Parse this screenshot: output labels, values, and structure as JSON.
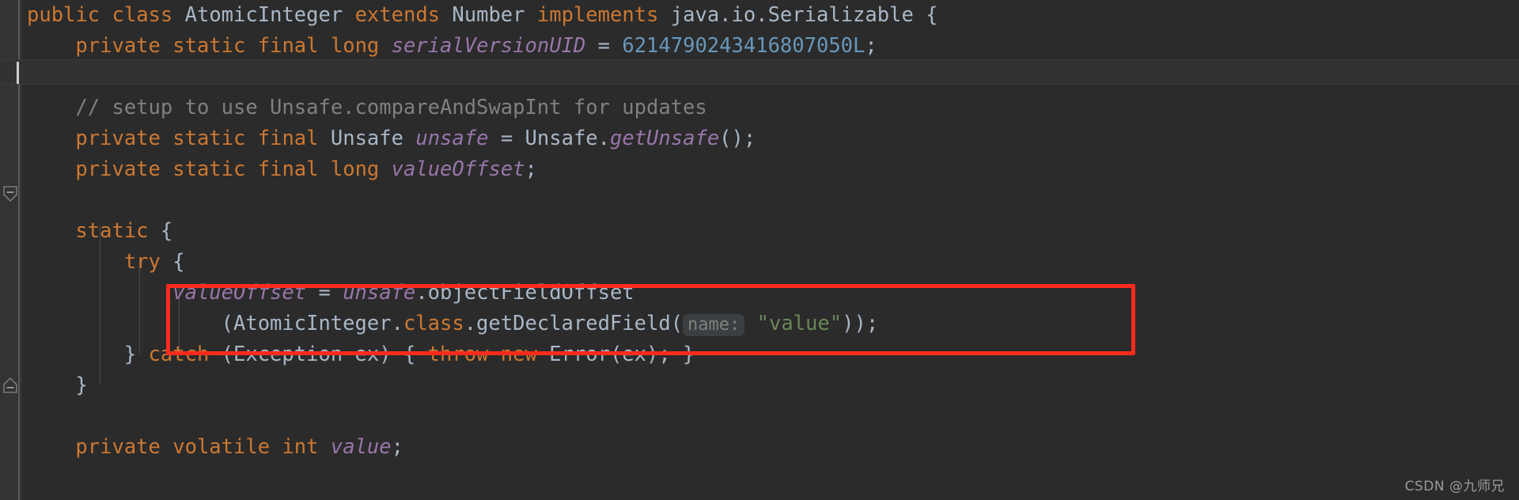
{
  "editor": {
    "theme_name": "darcula",
    "background_color": "#2b2b2b",
    "gutter_color": "#313335",
    "caret_line_color": "#323232",
    "annotation_box_color": "#fb2b1d",
    "colors": {
      "keyword": "#cc7832",
      "class_name": "#a9b7c6",
      "field": "#9876aa",
      "number": "#6897bb",
      "string": "#6a8759",
      "comment": "#808080",
      "param_hint": "#808080",
      "param_hint_bg": "#3c3f41"
    },
    "gutter": {
      "fold_markers": [
        {
          "name": "fold-marker-collapse-static",
          "state": "expanded-start"
        },
        {
          "name": "fold-marker-collapse-end",
          "state": "expanded-end"
        }
      ]
    },
    "lines": [
      {
        "id": 1,
        "tokens": [
          {
            "t": "public",
            "c": "kw"
          },
          {
            "t": " ",
            "c": "plain"
          },
          {
            "t": "class",
            "c": "kw"
          },
          {
            "t": " ",
            "c": "plain"
          },
          {
            "t": "AtomicInteger",
            "c": "cls"
          },
          {
            "t": " ",
            "c": "plain"
          },
          {
            "t": "extends",
            "c": "kw"
          },
          {
            "t": " ",
            "c": "plain"
          },
          {
            "t": "Number",
            "c": "cls"
          },
          {
            "t": " ",
            "c": "plain"
          },
          {
            "t": "implements",
            "c": "kw"
          },
          {
            "t": " ",
            "c": "plain"
          },
          {
            "t": "java.io.Serializable",
            "c": "cls"
          },
          {
            "t": " {",
            "c": "punct"
          }
        ]
      },
      {
        "id": 2,
        "tokens": [
          {
            "t": "    ",
            "c": "plain"
          },
          {
            "t": "private",
            "c": "kw"
          },
          {
            "t": " ",
            "c": "plain"
          },
          {
            "t": "static",
            "c": "kw"
          },
          {
            "t": " ",
            "c": "plain"
          },
          {
            "t": "final",
            "c": "kw"
          },
          {
            "t": " ",
            "c": "plain"
          },
          {
            "t": "long",
            "c": "kw"
          },
          {
            "t": " ",
            "c": "plain"
          },
          {
            "t": "serialVersionUID",
            "c": "fld"
          },
          {
            "t": " = ",
            "c": "punct"
          },
          {
            "t": "6214790243416807050L",
            "c": "num"
          },
          {
            "t": ";",
            "c": "punct"
          }
        ]
      },
      {
        "id": 3,
        "caret": true,
        "tokens": []
      },
      {
        "id": 4,
        "tokens": [
          {
            "t": "    ",
            "c": "plain"
          },
          {
            "t": "// setup to use Unsafe.compareAndSwapInt for updates",
            "c": "cmt"
          }
        ]
      },
      {
        "id": 5,
        "tokens": [
          {
            "t": "    ",
            "c": "plain"
          },
          {
            "t": "private",
            "c": "kw"
          },
          {
            "t": " ",
            "c": "plain"
          },
          {
            "t": "static",
            "c": "kw"
          },
          {
            "t": " ",
            "c": "plain"
          },
          {
            "t": "final",
            "c": "kw"
          },
          {
            "t": " ",
            "c": "plain"
          },
          {
            "t": "Unsafe",
            "c": "cls"
          },
          {
            "t": " ",
            "c": "plain"
          },
          {
            "t": "unsafe",
            "c": "fld"
          },
          {
            "t": " = ",
            "c": "punct"
          },
          {
            "t": "Unsafe.",
            "c": "cls"
          },
          {
            "t": "getUnsafe",
            "c": "fld"
          },
          {
            "t": "();",
            "c": "punct"
          }
        ]
      },
      {
        "id": 6,
        "tokens": [
          {
            "t": "    ",
            "c": "plain"
          },
          {
            "t": "private",
            "c": "kw"
          },
          {
            "t": " ",
            "c": "plain"
          },
          {
            "t": "static",
            "c": "kw"
          },
          {
            "t": " ",
            "c": "plain"
          },
          {
            "t": "final",
            "c": "kw"
          },
          {
            "t": " ",
            "c": "plain"
          },
          {
            "t": "long",
            "c": "kw"
          },
          {
            "t": " ",
            "c": "plain"
          },
          {
            "t": "valueOffset",
            "c": "fld"
          },
          {
            "t": ";",
            "c": "punct"
          }
        ]
      },
      {
        "id": 7,
        "tokens": []
      },
      {
        "id": 8,
        "tokens": [
          {
            "t": "    ",
            "c": "plain"
          },
          {
            "t": "static",
            "c": "kw"
          },
          {
            "t": " {",
            "c": "punct"
          }
        ]
      },
      {
        "id": 9,
        "tokens": [
          {
            "t": "        ",
            "c": "plain"
          },
          {
            "t": "try",
            "c": "kw"
          },
          {
            "t": " {",
            "c": "punct"
          }
        ]
      },
      {
        "id": 10,
        "tokens": [
          {
            "t": "            ",
            "c": "plain"
          },
          {
            "t": "valueOffset",
            "c": "fld"
          },
          {
            "t": " = ",
            "c": "punct"
          },
          {
            "t": "unsafe",
            "c": "fld"
          },
          {
            "t": ".objectFieldOffset",
            "c": "plain"
          }
        ]
      },
      {
        "id": 11,
        "tokens": [
          {
            "t": "                ",
            "c": "plain"
          },
          {
            "t": "(AtomicInteger.",
            "c": "plain"
          },
          {
            "t": "class",
            "c": "kw"
          },
          {
            "t": ".getDeclaredField(",
            "c": "plain"
          },
          {
            "t": "name:",
            "c": "hint"
          },
          {
            "t": " ",
            "c": "plain"
          },
          {
            "t": "\"value\"",
            "c": "str"
          },
          {
            "t": "));",
            "c": "punct"
          }
        ]
      },
      {
        "id": 12,
        "tokens": [
          {
            "t": "        } ",
            "c": "punct"
          },
          {
            "t": "catch",
            "c": "kw"
          },
          {
            "t": " (Exception ex) { ",
            "c": "plain"
          },
          {
            "t": "throw",
            "c": "kw"
          },
          {
            "t": " ",
            "c": "plain"
          },
          {
            "t": "new",
            "c": "kw"
          },
          {
            "t": " Error(ex); }",
            "c": "plain"
          }
        ]
      },
      {
        "id": 13,
        "tokens": [
          {
            "t": "    }",
            "c": "punct"
          }
        ]
      },
      {
        "id": 14,
        "tokens": []
      },
      {
        "id": 15,
        "tokens": [
          {
            "t": "    ",
            "c": "plain"
          },
          {
            "t": "private",
            "c": "kw"
          },
          {
            "t": " ",
            "c": "plain"
          },
          {
            "t": "volatile",
            "c": "kw"
          },
          {
            "t": " ",
            "c": "plain"
          },
          {
            "t": "int",
            "c": "kw"
          },
          {
            "t": " ",
            "c": "plain"
          },
          {
            "t": "value",
            "c": "fld"
          },
          {
            "t": ";",
            "c": "punct"
          }
        ]
      }
    ]
  },
  "annotation": {
    "name": "red-highlight-box",
    "color": "#fb2b1d"
  },
  "watermark": {
    "text": "CSDN @九师兄"
  }
}
